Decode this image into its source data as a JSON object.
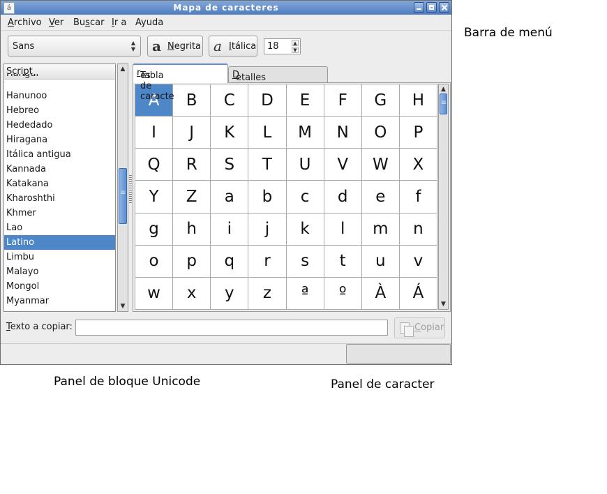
{
  "window": {
    "title": "Mapa de caracteres",
    "app_icon": "á"
  },
  "menu": [
    {
      "label": "Archivo",
      "mnemonic": "A",
      "rest": "rchivo"
    },
    {
      "label": "Ver",
      "mnemonic": "V",
      "rest": "er"
    },
    {
      "label": "Buscar",
      "pre": "Bu",
      "mnemonic": "s",
      "rest": "car"
    },
    {
      "label": "Ir a",
      "mnemonic": "I",
      "rest": "r a"
    },
    {
      "label": "Ayuda",
      "mnemonic": "A",
      "rest": "yuda"
    }
  ],
  "toolbar": {
    "font": "Sans",
    "bold": {
      "icon": "a",
      "mnemonic": "N",
      "rest": "egrita"
    },
    "italic": {
      "icon": "a",
      "mnemonic": "I",
      "rest": "tálica"
    },
    "size": "18"
  },
  "scripts": {
    "header": "Script",
    "peek": "Hangul",
    "items": [
      "Hanunoo",
      "Hebreo",
      "Hededado",
      "Hiragana",
      "Itálica antigua",
      "Kannada",
      "Katakana",
      "Kharoshthi",
      "Khmer",
      "Lao",
      "Latino",
      "Limbu",
      "Malayo",
      "Mongol",
      "Myanmar"
    ],
    "selected": "Latino"
  },
  "tabs": {
    "table": {
      "pre": "Tabla de caracte",
      "mnemonic": "r",
      "rest": "es"
    },
    "details": {
      "mnemonic": "D",
      "rest": "etalles del carácter"
    }
  },
  "chars": [
    "A",
    "B",
    "C",
    "D",
    "E",
    "F",
    "G",
    "H",
    "I",
    "J",
    "K",
    "L",
    "M",
    "N",
    "O",
    "P",
    "Q",
    "R",
    "S",
    "T",
    "U",
    "V",
    "W",
    "X",
    "Y",
    "Z",
    "a",
    "b",
    "c",
    "d",
    "e",
    "f",
    "g",
    "h",
    "i",
    "j",
    "k",
    "l",
    "m",
    "n",
    "o",
    "p",
    "q",
    "r",
    "s",
    "t",
    "u",
    "v",
    "w",
    "x",
    "y",
    "z",
    "ª",
    "º",
    "À",
    "Á"
  ],
  "selected_char": "A",
  "copy": {
    "pre": "",
    "mnemonic": "T",
    "rest": "exto a copiar:",
    "value": "",
    "button_mnemonic": "C",
    "button_rest": "opiar"
  },
  "annotations": {
    "menu_bar": "Barra de menú",
    "block_panel": "Panel de bloque Unicode",
    "char_panel": "Panel de caracter"
  },
  "colors": {
    "selection": "#4d87c8",
    "title_gradient": [
      "#83a8d8",
      "#4f7cc0"
    ]
  }
}
